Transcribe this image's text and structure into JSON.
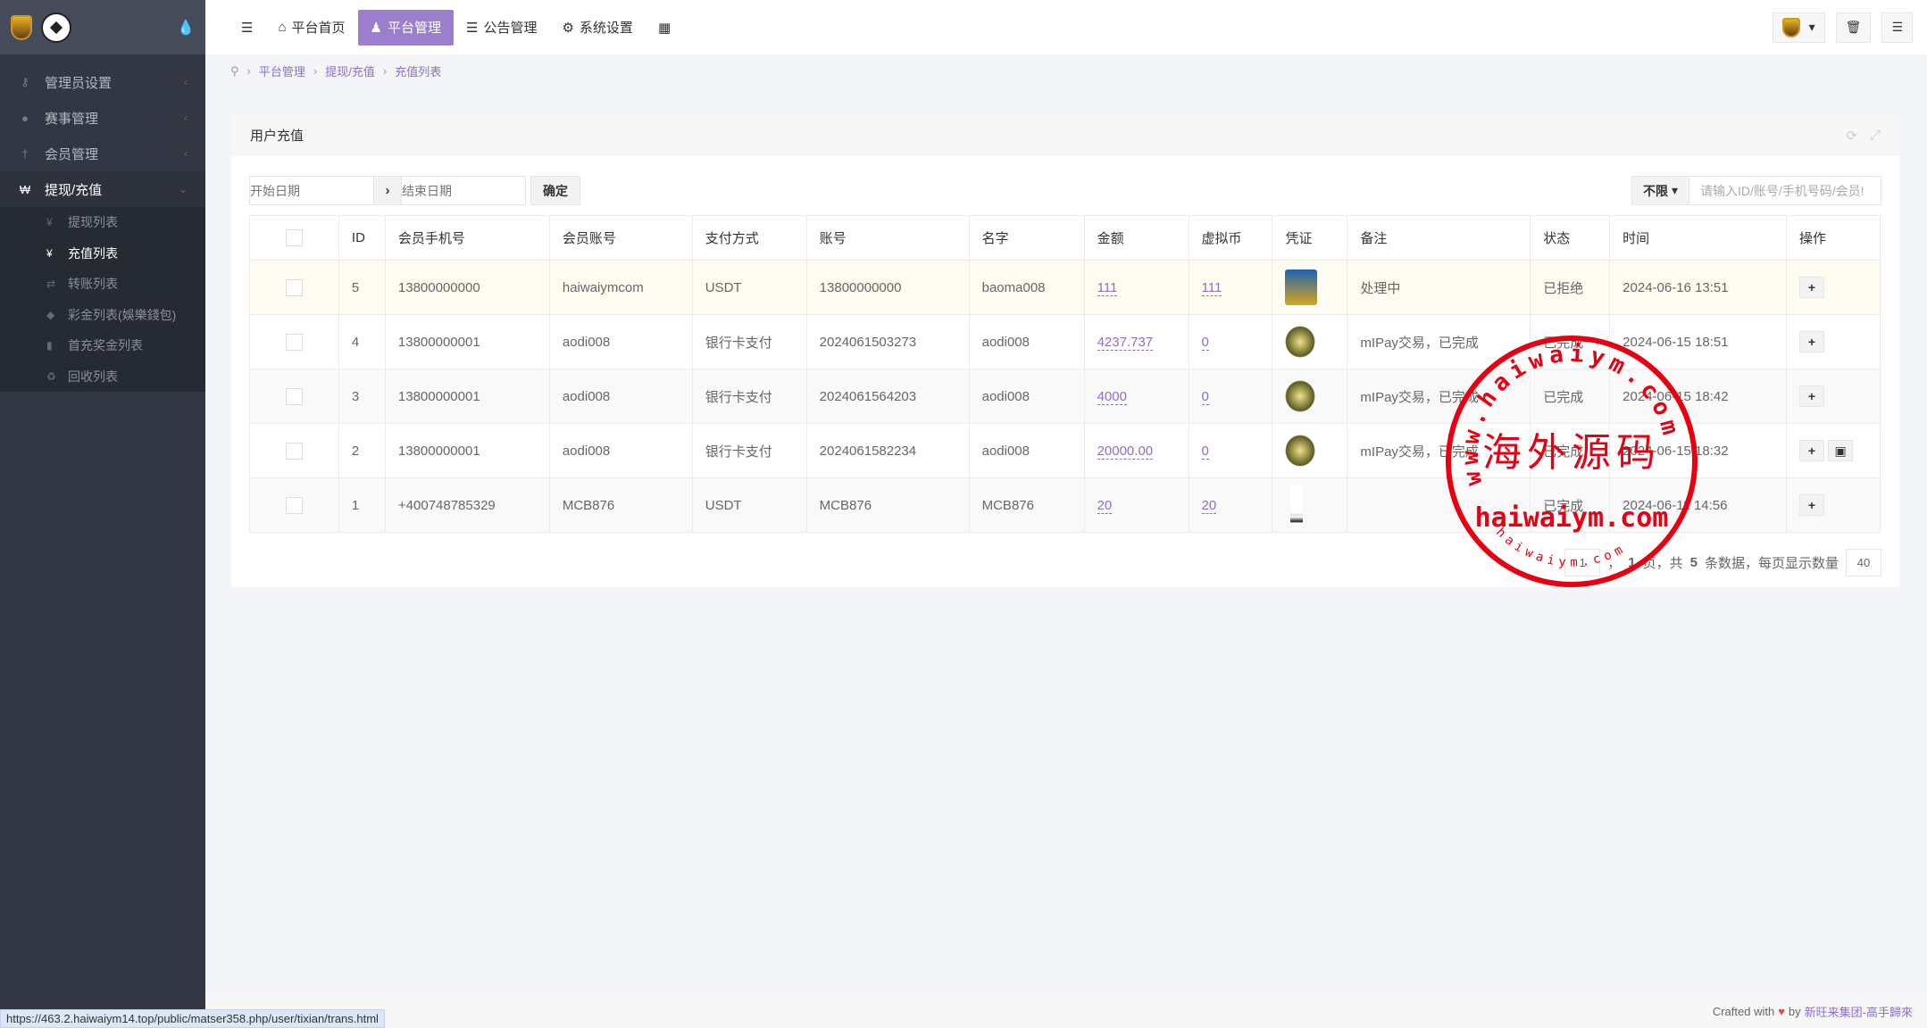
{
  "sidebar": {
    "items": [
      {
        "label": "管理员设置",
        "icon": "key-icon"
      },
      {
        "label": "赛事管理",
        "icon": "users-icon"
      },
      {
        "label": "会员管理",
        "icon": "user-icon"
      },
      {
        "label": "提现/充值",
        "icon": "won-icon"
      }
    ],
    "sub": [
      {
        "label": "提现列表",
        "icon": "yen-icon"
      },
      {
        "label": "充值列表",
        "icon": "yen-icon"
      },
      {
        "label": "转账列表",
        "icon": "exchange-icon"
      },
      {
        "label": "彩金列表(娛樂錢包)",
        "icon": "diamond-icon"
      },
      {
        "label": "首充奖金列表",
        "icon": "file-icon"
      },
      {
        "label": "回收列表",
        "icon": "recycle-icon"
      }
    ]
  },
  "topnav": {
    "items": [
      "平台首页",
      "平台管理",
      "公告管理",
      "系统设置"
    ]
  },
  "breadcrumb": [
    "平台管理",
    "提现/充值",
    "充值列表"
  ],
  "panel": {
    "title": "用户充值"
  },
  "filter": {
    "start_placeholder": "开始日期",
    "end_placeholder": "结束日期",
    "confirm": "确定",
    "select": "不限",
    "search_placeholder": "请输入ID/账号/手机号码/会员!"
  },
  "table": {
    "headers": [
      "ID",
      "会员手机号",
      "会员账号",
      "支付方式",
      "账号",
      "名字",
      "金额",
      "虚拟币",
      "凭证",
      "备注",
      "状态",
      "时间",
      "操作"
    ],
    "rows": [
      {
        "id": "5",
        "phone": "13800000000",
        "account": "haiwaiymcom",
        "pay": "USDT",
        "acct": "13800000000",
        "name": "baoma008",
        "amount": "111",
        "coin": "111",
        "note": "处理中",
        "status": "已拒绝",
        "time": "2024-06-16 13:51"
      },
      {
        "id": "4",
        "phone": "13800000001",
        "account": "aodi008",
        "pay": "银行卡支付",
        "acct": "2024061503273",
        "name": "aodi008",
        "amount": "4237.737",
        "coin": "0",
        "note": "mIPay交易，已完成",
        "status": "已完成",
        "time": "2024-06-15 18:51"
      },
      {
        "id": "3",
        "phone": "13800000001",
        "account": "aodi008",
        "pay": "银行卡支付",
        "acct": "2024061564203",
        "name": "aodi008",
        "amount": "4000",
        "coin": "0",
        "note": "mIPay交易，已完成",
        "status": "已完成",
        "time": "2024-06-15 18:42"
      },
      {
        "id": "2",
        "phone": "13800000001",
        "account": "aodi008",
        "pay": "银行卡支付",
        "acct": "2024061582234",
        "name": "aodi008",
        "amount": "20000.00",
        "coin": "0",
        "note": "mIPay交易，已完成",
        "status": "已完成",
        "time": "2024-06-15 18:32"
      },
      {
        "id": "1",
        "phone": "+400748785329",
        "account": "MCB876",
        "pay": "USDT",
        "acct": "MCB876",
        "name": "MCB876",
        "amount": "20",
        "coin": "20",
        "note": "",
        "status": "已完成",
        "time": "2024-06-11 14:56"
      }
    ]
  },
  "pager": {
    "pre": "，",
    "pages": "1",
    "mid1": "页，共",
    "total": "5",
    "mid2": "条数据，每页显示数量",
    "per_page": "40"
  },
  "footer": {
    "crafted": "Crafted with",
    "by": "by",
    "link": "新旺来集团-高手歸來"
  },
  "status_url": "https://463.2.haiwaiym14.top/public/matser358.php/user/tixian/trans.html",
  "watermark": {
    "ring": "www.haiwaiym.com",
    "center": "海外源码",
    "bottom": "haiwaiym.com",
    "small": "haiwaiym.com"
  },
  "colors": {
    "accent": "#9b7fcc",
    "sidebar": "#333744",
    "stamp": "#e60012"
  }
}
